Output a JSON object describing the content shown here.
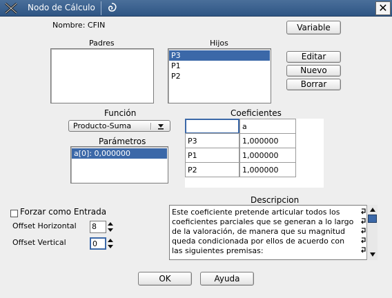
{
  "window": {
    "title": "Nodo de Cálculo",
    "close_glyph": "✕"
  },
  "nombre_label": "Nombre: CFIN",
  "buttons": {
    "variable": "Variable",
    "editar": "Editar",
    "nuevo": "Nuevo",
    "borrar": "Borrar",
    "ok": "OK",
    "ayuda": "Ayuda"
  },
  "padres": {
    "heading": "Padres",
    "items": []
  },
  "hijos": {
    "heading": "Hijos",
    "items": [
      {
        "label": "P3",
        "selected": true
      },
      {
        "label": "P1",
        "selected": false
      },
      {
        "label": "P2",
        "selected": false
      }
    ]
  },
  "funcion": {
    "heading": "Función",
    "selected": "Producto-Suma"
  },
  "parametros": {
    "heading": "Parámetros",
    "items": [
      {
        "label": "a[0]: 0,000000",
        "selected": true
      }
    ]
  },
  "coeficientes": {
    "heading": "Coeficientes",
    "header": [
      "",
      "a"
    ],
    "rows": [
      [
        "P3",
        "1,000000"
      ],
      [
        "P1",
        "1,000000"
      ],
      [
        "P2",
        "1,000000"
      ]
    ]
  },
  "forzar_entrada": {
    "label": "Forzar como Entrada",
    "checked": false
  },
  "offset_horizontal": {
    "label": "Offset Horizontal",
    "value": "8"
  },
  "offset_vertical": {
    "label": "Offset Vertical",
    "value": "0"
  },
  "descripcion": {
    "heading": "Descripcion",
    "lines": [
      "Este coeficiente pretende articular todos los",
      "coeficientes parciales que se generan a lo largo",
      "de la valoración, de manera que su magnitud",
      "queda condicionada por ellos de acuerdo con",
      "las siguientes premisas:"
    ]
  },
  "colors": {
    "titlebar": "#2e5584",
    "selection": "#3b68a8",
    "dialog_bg": "#eeeeee"
  },
  "icons": {
    "app": "x-app-icon",
    "swirl": "swirl-icon",
    "close": "close-icon",
    "dropdown": "chevron-down-icon",
    "spin_up": "spin-up-icon",
    "spin_down": "spin-down-icon",
    "wrap": "line-wrap-icon"
  }
}
